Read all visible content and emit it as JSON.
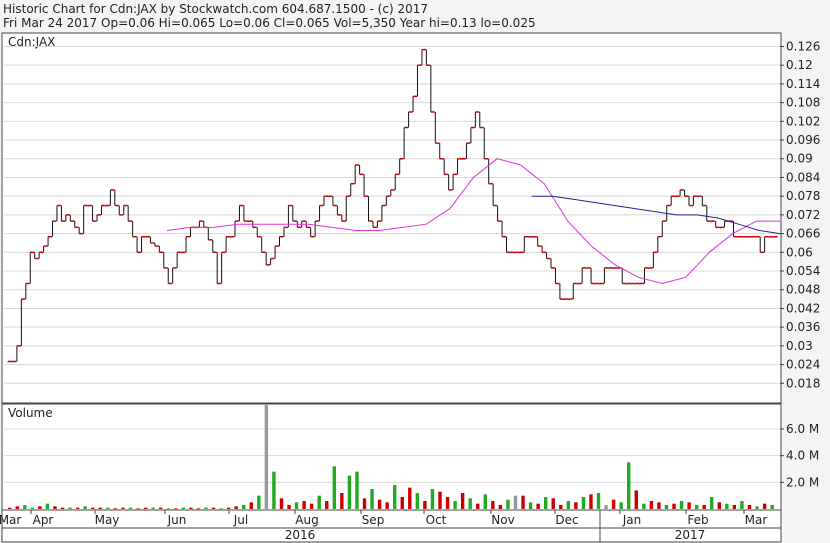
{
  "header": {
    "line1": "Historic Chart for Cdn:JAX by Stockwatch.com 604.687.1500 - (c) 2017",
    "line2": "Fri Mar 24 2017   Op=0.06   Hi=0.065   Lo=0.06   Cl=0.065   Vol=5,350   Year hi=0.13   lo=0.025"
  },
  "chart_data": [
    {
      "type": "line",
      "title": "Cdn:JAX",
      "ylim": [
        0.012,
        0.13
      ],
      "y_ticks": [
        "0.126",
        "0.12",
        "0.114",
        "0.108",
        "0.102",
        "0.096",
        "0.09",
        "0.084",
        "0.078",
        "0.072",
        "0.066",
        "0.06",
        "0.054",
        "0.048",
        "0.042",
        "0.036",
        "0.03",
        "0.024",
        "0.018"
      ],
      "series": [
        {
          "kind": "ohlc",
          "color": "#cc0000",
          "values": [
            0.025,
            0.025,
            0.03,
            0.045,
            0.05,
            0.06,
            0.058,
            0.06,
            0.062,
            0.065,
            0.07,
            0.075,
            0.07,
            0.072,
            0.07,
            0.068,
            0.066,
            0.075,
            0.075,
            0.07,
            0.072,
            0.075,
            0.075,
            0.08,
            0.075,
            0.072,
            0.075,
            0.07,
            0.065,
            0.06,
            0.065,
            0.065,
            0.063,
            0.062,
            0.06,
            0.055,
            0.05,
            0.055,
            0.06,
            0.06,
            0.065,
            0.068,
            0.068,
            0.07,
            0.068,
            0.064,
            0.06,
            0.05,
            0.06,
            0.065,
            0.065,
            0.07,
            0.075,
            0.07,
            0.07,
            0.068,
            0.065,
            0.06,
            0.056,
            0.058,
            0.062,
            0.065,
            0.068,
            0.075,
            0.07,
            0.068,
            0.07,
            0.068,
            0.065,
            0.07,
            0.075,
            0.078,
            0.078,
            0.075,
            0.072,
            0.07,
            0.078,
            0.082,
            0.088,
            0.085,
            0.078,
            0.07,
            0.068,
            0.07,
            0.075,
            0.078,
            0.08,
            0.085,
            0.09,
            0.1,
            0.105,
            0.11,
            0.12,
            0.125,
            0.12,
            0.105,
            0.095,
            0.09,
            0.085,
            0.08,
            0.085,
            0.09,
            0.09,
            0.095,
            0.1,
            0.105,
            0.1,
            0.09,
            0.082,
            0.075,
            0.07,
            0.065,
            0.06,
            0.06,
            0.06,
            0.06,
            0.065,
            0.065,
            0.065,
            0.062,
            0.06,
            0.058,
            0.055,
            0.05,
            0.045,
            0.045,
            0.045,
            0.05,
            0.05,
            0.055,
            0.055,
            0.05,
            0.05,
            0.05,
            0.055,
            0.055,
            0.055,
            0.055,
            0.05,
            0.05,
            0.05,
            0.05,
            0.05,
            0.055,
            0.055,
            0.06,
            0.065,
            0.07,
            0.075,
            0.078,
            0.078,
            0.08,
            0.078,
            0.075,
            0.078,
            0.078,
            0.075,
            0.07,
            0.07,
            0.068,
            0.068,
            0.07,
            0.07,
            0.065,
            0.065,
            0.065,
            0.065,
            0.065,
            0.065,
            0.06,
            0.065,
            0.065,
            0.065
          ]
        },
        {
          "kind": "moving-average",
          "color": "#dd33dd",
          "values": [
            0.067,
            0.068,
            0.068,
            0.069,
            0.069,
            0.069,
            0.069,
            0.068,
            0.067,
            0.067,
            0.068,
            0.069,
            0.074,
            0.084,
            0.09,
            0.088,
            0.082,
            0.07,
            0.062,
            0.056,
            0.052,
            0.05,
            0.052,
            0.06,
            0.066,
            0.07,
            0.07
          ]
        },
        {
          "kind": "moving-average",
          "color": "#22229a",
          "values": [
            0.078,
            0.078,
            0.077,
            0.076,
            0.075,
            0.074,
            0.073,
            0.072,
            0.072,
            0.071,
            0.069,
            0.067,
            0.066
          ]
        }
      ]
    },
    {
      "type": "bar",
      "title": "Volume",
      "ylim": [
        0,
        7.8
      ],
      "y_ticks": [
        "6.0 M",
        "4.0 M",
        "2.0 M"
      ],
      "x_month_labels": [
        "Mar",
        "Apr",
        "May",
        "Jun",
        "Jul",
        "Aug",
        "Sep",
        "Oct",
        "Nov",
        "Dec",
        "Jan",
        "Feb",
        "Mar"
      ],
      "x_year_labels": [
        "2016",
        "2017"
      ],
      "colors": {
        "up": "#22aa22",
        "down": "#cc0000",
        "flat": "#999999"
      },
      "values": [
        0.1,
        0.2,
        0.3,
        0.1,
        0.2,
        0.4,
        0.2,
        0.1,
        0.1,
        0.1,
        0.2,
        0.1,
        0.1,
        0.1,
        0.05,
        0.1,
        0.1,
        0.05,
        0.1,
        0.1,
        0.1,
        0.05,
        0.05,
        0.1,
        0.1,
        0.05,
        0.1,
        0.1,
        0.05,
        0.1,
        0.2,
        0.3,
        0.5,
        1.0,
        7.8,
        2.8,
        0.8,
        0.3,
        0.5,
        0.6,
        0.4,
        1.0,
        0.6,
        3.2,
        1.2,
        2.5,
        2.8,
        0.8,
        1.5,
        0.7,
        0.5,
        1.8,
        0.9,
        1.6,
        1.2,
        0.6,
        1.5,
        1.3,
        0.9,
        0.6,
        1.2,
        0.8,
        0.4,
        1.1,
        0.6,
        0.3,
        0.7,
        1.0,
        1.0,
        0.5,
        0.4,
        0.9,
        0.8,
        0.3,
        0.6,
        0.5,
        0.9,
        1.1,
        1.2,
        0.3,
        0.7,
        0.5,
        3.5,
        1.4,
        0.4,
        0.6,
        0.5,
        0.3,
        0.4,
        0.6,
        0.5,
        0.3,
        0.3,
        0.9,
        0.5,
        0.4,
        0.3,
        0.6,
        0.3,
        0.2,
        0.4,
        0.3
      ],
      "signs": [
        "d",
        "d",
        "u",
        "u",
        "d",
        "u",
        "d",
        "d",
        "u",
        "d",
        "u",
        "d",
        "d",
        "u",
        "d",
        "d",
        "u",
        "d",
        "d",
        "u",
        "d",
        "u",
        "d",
        "u",
        "d",
        "d",
        "u",
        "d",
        "u",
        "d",
        "d",
        "u",
        "d",
        "u",
        "f",
        "u",
        "d",
        "d",
        "u",
        "d",
        "d",
        "u",
        "d",
        "u",
        "d",
        "u",
        "u",
        "d",
        "u",
        "d",
        "d",
        "u",
        "d",
        "d",
        "u",
        "d",
        "u",
        "d",
        "d",
        "u",
        "d",
        "u",
        "d",
        "u",
        "d",
        "d",
        "u",
        "f",
        "d",
        "u",
        "d",
        "u",
        "d",
        "d",
        "u",
        "d",
        "u",
        "d",
        "u",
        "f",
        "d",
        "u",
        "u",
        "d",
        "u",
        "d",
        "d",
        "u",
        "d",
        "u",
        "d",
        "u",
        "d",
        "u",
        "d",
        "u",
        "d",
        "u",
        "d",
        "u",
        "d",
        "u"
      ]
    }
  ]
}
